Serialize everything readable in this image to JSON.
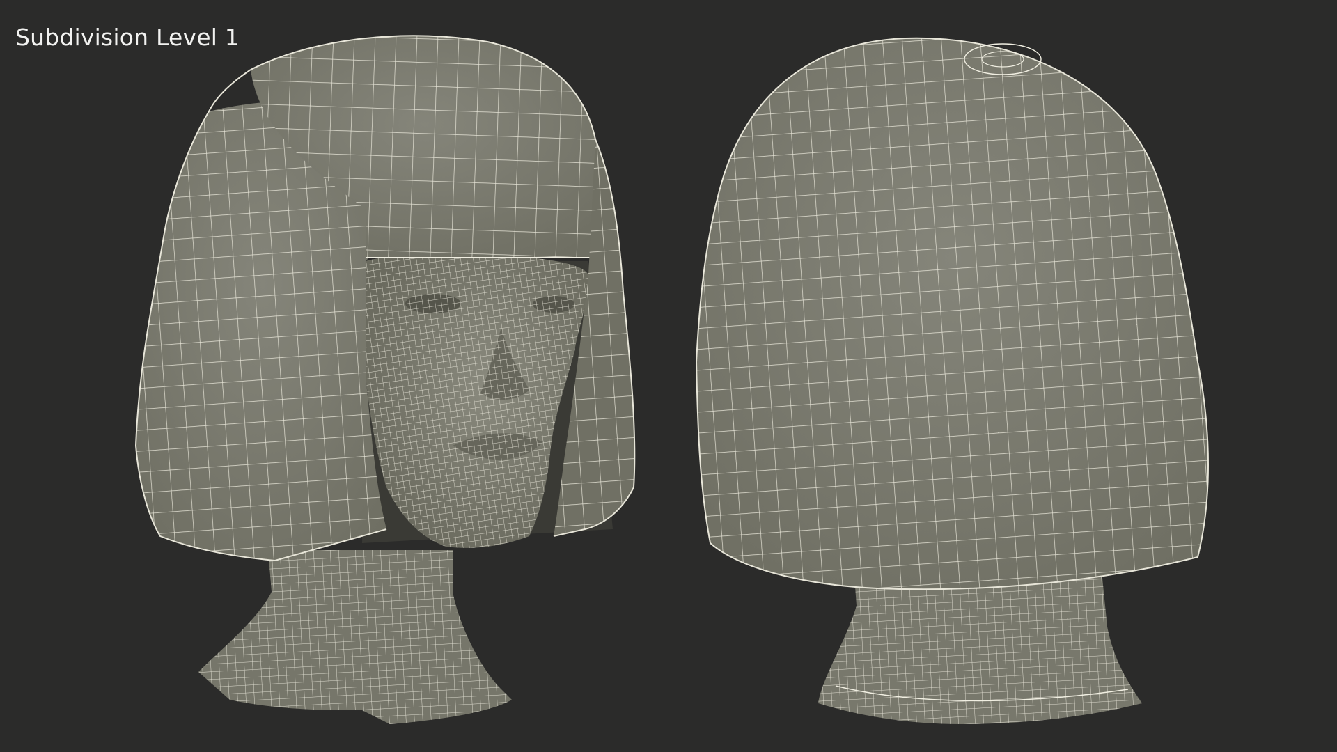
{
  "caption": "Subdivision Level 1",
  "colors": {
    "background": "#2b2b2a",
    "mesh_fill": "#7b7b6d",
    "mesh_fill_shadow": "#5f5f54",
    "wire": "#f1efe2"
  },
  "views": [
    {
      "name": "front-three-quarter-view",
      "subject": "head-with-bob-hair"
    },
    {
      "name": "back-view",
      "subject": "head-with-bob-hair"
    }
  ]
}
